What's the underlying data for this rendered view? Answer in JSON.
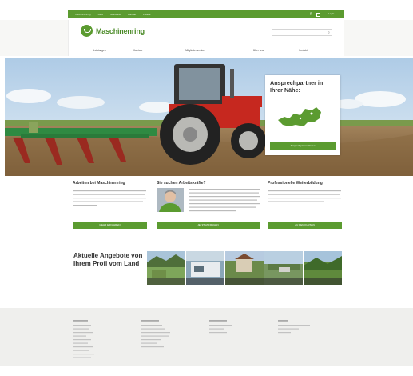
{
  "topbar": {
    "links": [
      "Maschinenring",
      "Jobs",
      "Standorte",
      "Kontakt",
      "Presse"
    ],
    "login_label": "Login"
  },
  "header": {
    "logo_text": "Maschinenring",
    "search_placeholder": ""
  },
  "nav": {
    "items": [
      "Leistungen",
      "Karriere",
      "Mitgliederservice",
      "Über uns",
      "Kontakt"
    ]
  },
  "hero": {
    "contact_title": "Ansprechpartner in Ihrer Nähe:",
    "contact_button": "Ansprechpartner finden"
  },
  "columns": [
    {
      "title": "Arbeiten bei Maschinenring",
      "text": "",
      "button": "MEHR ERFAHREN"
    },
    {
      "title": "Sie suchen Arbeitskräfte?",
      "text": "",
      "button": "JETZT ANFRAGEN"
    },
    {
      "title": "Professionelle Weiterbildung",
      "text": "",
      "button": "ZU DEN KURSEN"
    }
  ],
  "angebote": {
    "title": "Aktuelle Angebote von Ihrem Profi vom Land",
    "items": [
      "",
      "",
      "",
      "",
      ""
    ]
  },
  "footer": {
    "columns": [
      {
        "heading": "",
        "items": [
          "",
          "",
          "",
          "",
          "",
          "",
          "",
          "",
          "",
          ""
        ]
      },
      {
        "heading": "",
        "items": [
          "",
          "",
          "",
          "",
          "",
          "",
          "",
          ""
        ]
      },
      {
        "heading": "",
        "items": [
          "",
          "",
          "",
          ""
        ]
      },
      {
        "heading": "",
        "items": [
          "",
          "",
          ""
        ]
      }
    ]
  },
  "colors": {
    "brand_green": "#5b9b30",
    "footer_bg": "#efefed"
  },
  "icons": [
    "facebook-icon",
    "share-icon",
    "search-icon"
  ]
}
